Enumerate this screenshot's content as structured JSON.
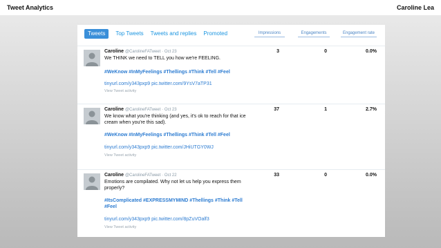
{
  "header": {
    "title": "Tweet Analytics",
    "user": "Caroline Lea"
  },
  "tabs": [
    {
      "label": "Tweets",
      "active": true
    },
    {
      "label": "Top Tweets",
      "active": false
    },
    {
      "label": "Tweets and replies",
      "active": false
    },
    {
      "label": "Promoted",
      "active": false
    }
  ],
  "columns": {
    "impressions": "Impressions",
    "engagements": "Engagements",
    "rate": "Engagement rate"
  },
  "tweets": [
    {
      "name": "Caroline",
      "handle": "@CarolineFATweet",
      "date": "· Oct 23",
      "text": "We THINK we need to TELL you how we're FEELING.",
      "tags": "#WeKnow #InMyFeelings #Thellings #Think #Tell #Feel",
      "link": "tinyurl.com/y343pxp9 pic.twitter.com/9YsV7aTP31",
      "activity": "View Tweet activity",
      "impressions": "3",
      "engagements": "0",
      "rate": "0.0%"
    },
    {
      "name": "Caroline",
      "handle": "@CarolineFATweet",
      "date": "· Oct 23",
      "text": "We know what you're thinking (and yes, it's ok to reach for that ice cream when you're this sad).",
      "tags": "#WeKnow #InMyFeelings #Thellings #Think #Tell #Feel",
      "link": "tinyurl.com/y343pxp9 pic.twitter.com/JHiUTGY0WJ",
      "activity": "View Tweet activity",
      "impressions": "37",
      "engagements": "1",
      "rate": "2.7%"
    },
    {
      "name": "Caroline",
      "handle": "@CarolineFATweet",
      "date": "· Oct 22",
      "text": "Emotions are compilated. Why not let us help you express them properly?",
      "tags": "#ItsComplicated #EXPRESSMYMIND #Thellings #Think #Tell #Feel",
      "link": "tinyurl.com/y343pxp9 pic.twitter.com/8pZuVOalf3",
      "activity": "View Tweet activity",
      "impressions": "33",
      "engagements": "0",
      "rate": "0.0%"
    }
  ]
}
